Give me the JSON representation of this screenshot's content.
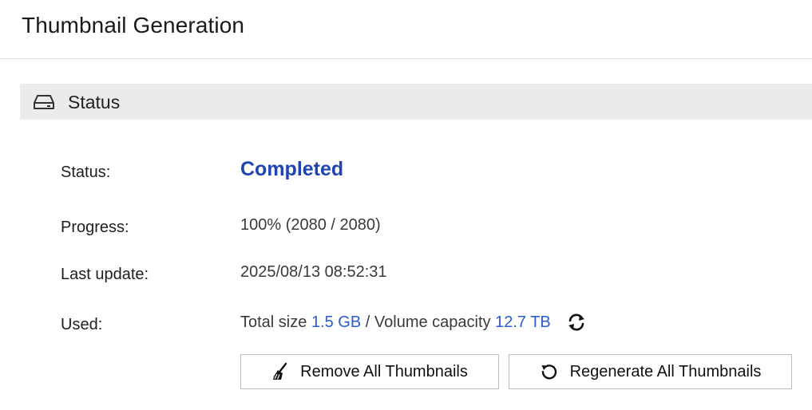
{
  "page": {
    "title": "Thumbnail Generation"
  },
  "section": {
    "title": "Status",
    "icon": "hard-drive-icon"
  },
  "status": {
    "label": "Status:",
    "value": "Completed",
    "value_color": "#1f45b5"
  },
  "progress": {
    "label": "Progress:",
    "value": "100% (2080 / 2080)",
    "percent": 100
  },
  "last_update": {
    "label": "Last update:",
    "value": "2025/08/13 08:52:31"
  },
  "used": {
    "label": "Used:",
    "total_size_label": "Total size",
    "total_size_value": "1.5 GB",
    "separator": "/",
    "volume_capacity_label": "Volume capacity",
    "volume_capacity_value": "12.7 TB",
    "refresh_icon": "refresh-icon",
    "link_color": "#2a5ccf"
  },
  "actions": {
    "remove_label": "Remove All Thumbnails",
    "remove_icon": "broom-icon",
    "regenerate_label": "Regenerate All Thumbnails",
    "regenerate_icon": "regenerate-icon"
  }
}
